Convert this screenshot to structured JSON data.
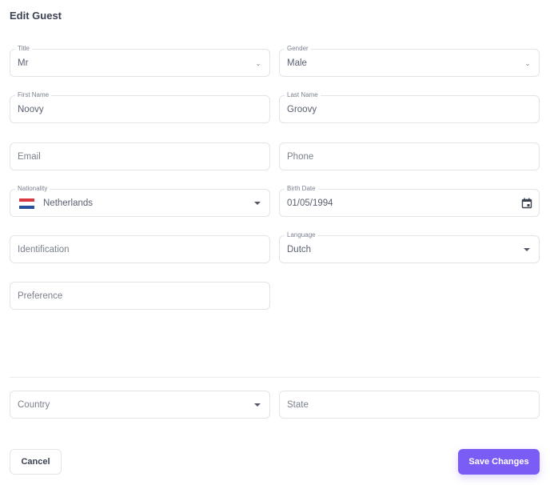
{
  "header": {
    "title": "Edit Guest"
  },
  "form": {
    "title": {
      "label": "Title",
      "value": "Mr"
    },
    "gender": {
      "label": "Gender",
      "value": "Male"
    },
    "first_name": {
      "label": "First Name",
      "value": "Noovy"
    },
    "last_name": {
      "label": "Last Name",
      "value": "Groovy"
    },
    "email": {
      "placeholder": "Email"
    },
    "phone": {
      "placeholder": "Phone"
    },
    "nationality": {
      "label": "Nationality",
      "value": "Netherlands",
      "flag": "netherlands-flag"
    },
    "birth_date": {
      "label": "Birth Date",
      "value": "01/05/1994"
    },
    "identification": {
      "placeholder": "Identification"
    },
    "language": {
      "label": "Language",
      "value": "Dutch"
    },
    "preference": {
      "placeholder": "Preference"
    },
    "country": {
      "placeholder": "Country"
    },
    "state": {
      "placeholder": "State"
    }
  },
  "actions": {
    "cancel_label": "Cancel",
    "save_label": "Save Changes"
  },
  "colors": {
    "accent": "#7b5cf5",
    "border": "#e2e4e8"
  }
}
